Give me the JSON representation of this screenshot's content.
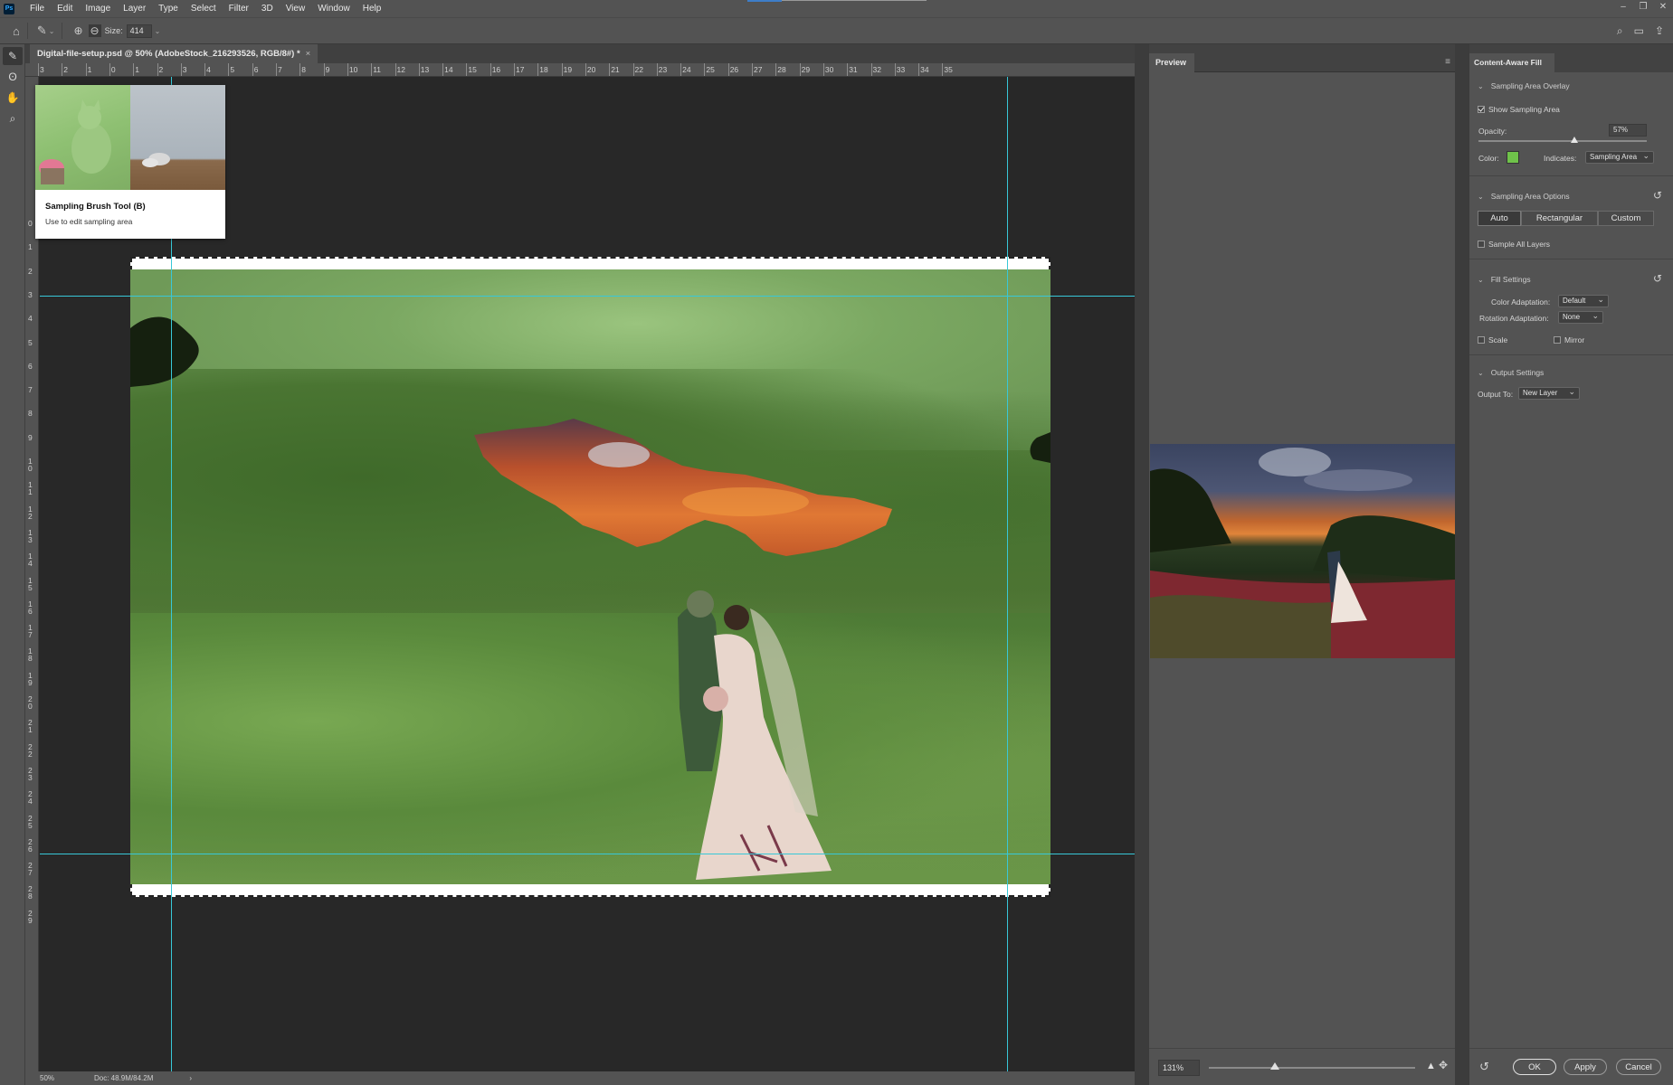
{
  "menu": {
    "items": [
      "File",
      "Edit",
      "Image",
      "Layer",
      "Type",
      "Select",
      "Filter",
      "3D",
      "View",
      "Window",
      "Help"
    ]
  },
  "options": {
    "size_label": "Size:",
    "size_value": "414"
  },
  "document": {
    "tab_title": "Digital-file-setup.psd @ 50% (AdobeStock_216293526, RGB/8#) *",
    "tab_close": "×"
  },
  "ruler": {
    "h_labels": [
      "3",
      "2",
      "1",
      "0",
      "1",
      "2",
      "3",
      "4",
      "5",
      "6",
      "7",
      "8",
      "9",
      "10",
      "11",
      "12",
      "13",
      "14",
      "15",
      "16",
      "17",
      "18",
      "19",
      "20",
      "21",
      "22",
      "23",
      "24",
      "25",
      "26",
      "27",
      "28",
      "29",
      "30",
      "31",
      "32",
      "33",
      "34",
      "35"
    ],
    "v_labels": [
      "0",
      "1",
      "2",
      "3",
      "4",
      "5",
      "6",
      "7",
      "8",
      "9",
      "1\n0",
      "1\n1",
      "1\n2",
      "1\n3",
      "1\n4",
      "1\n5",
      "1\n6",
      "1\n7",
      "1\n8",
      "1\n9",
      "2\n0",
      "2\n1",
      "2\n2",
      "2\n3",
      "2\n4",
      "2\n5",
      "2\n6",
      "2\n7",
      "2\n8",
      "2\n9"
    ]
  },
  "tooltip": {
    "title": "Sampling Brush Tool (B)",
    "subtitle": "Use to edit sampling area"
  },
  "status": {
    "zoom": "50%",
    "doc": "Doc: 48.9M/84.2M",
    "arrow": "›"
  },
  "preview": {
    "tab": "Preview",
    "zoom": "131%"
  },
  "caf": {
    "tab": "Content-Aware Fill",
    "sampling_overlay": {
      "title": "Sampling Area Overlay",
      "show_label": "Show Sampling Area",
      "show_checked": true,
      "opacity_label": "Opacity:",
      "opacity_value": "57%",
      "opacity_fraction": 0.57,
      "color_label": "Color:",
      "color_hex": "#6fc24a",
      "indicates_label": "Indicates:",
      "indicates_value": "Sampling Area"
    },
    "sampling_options": {
      "title": "Sampling Area Options",
      "modes": [
        "Auto",
        "Rectangular",
        "Custom"
      ],
      "active_mode": "Auto",
      "sample_all_label": "Sample All Layers"
    },
    "fill_settings": {
      "title": "Fill Settings",
      "color_adapt_label": "Color Adaptation:",
      "color_adapt_value": "Default",
      "rotation_label": "Rotation Adaptation:",
      "rotation_value": "None",
      "scale_label": "Scale",
      "mirror_label": "Mirror"
    },
    "output_settings": {
      "title": "Output Settings",
      "output_label": "Output To:",
      "output_value": "New Layer"
    },
    "buttons": {
      "ok": "OK",
      "apply": "Apply",
      "cancel": "Cancel"
    }
  },
  "colors": {
    "guide": "#38c8d8",
    "overlay_green": "#6fc24a"
  }
}
